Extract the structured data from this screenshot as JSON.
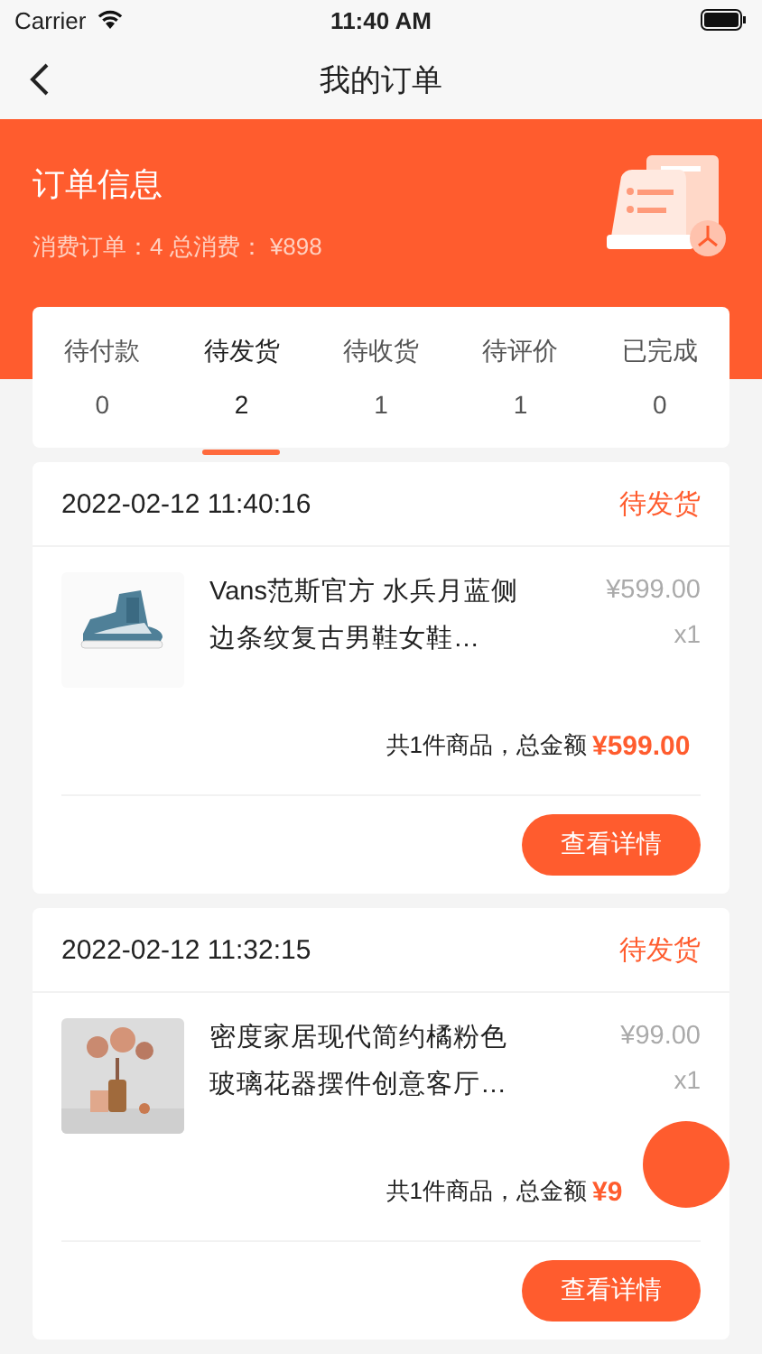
{
  "status_bar": {
    "carrier": "Carrier",
    "time": "11:40 AM"
  },
  "nav": {
    "title": "我的订单"
  },
  "header": {
    "title": "订单信息",
    "summary": "消费订单：4 总消费： ¥898"
  },
  "tabs": [
    {
      "label": "待付款",
      "count": "0",
      "selected": false
    },
    {
      "label": "待发货",
      "count": "2",
      "selected": true
    },
    {
      "label": "待收货",
      "count": "1",
      "selected": false
    },
    {
      "label": "待评价",
      "count": "1",
      "selected": false
    },
    {
      "label": "已完成",
      "count": "0",
      "selected": false
    }
  ],
  "orders": [
    {
      "time": "2022-02-12 11:40:16",
      "status": "待发货",
      "title": "Vans范斯官方 水兵月蓝侧边条纹复古男鞋女鞋…",
      "price": "¥599.00",
      "quantity": "x1",
      "summary": "共1件商品，总金额",
      "total": "¥599.00",
      "button": "查看详情"
    },
    {
      "time": "2022-02-12 11:32:15",
      "status": "待发货",
      "title": "密度家居现代简约橘粉色玻璃花器摆件创意客厅…",
      "price": "¥99.00",
      "quantity": "x1",
      "summary": "共1件商品，总金额",
      "total": "¥9",
      "button": "查看详情"
    }
  ]
}
